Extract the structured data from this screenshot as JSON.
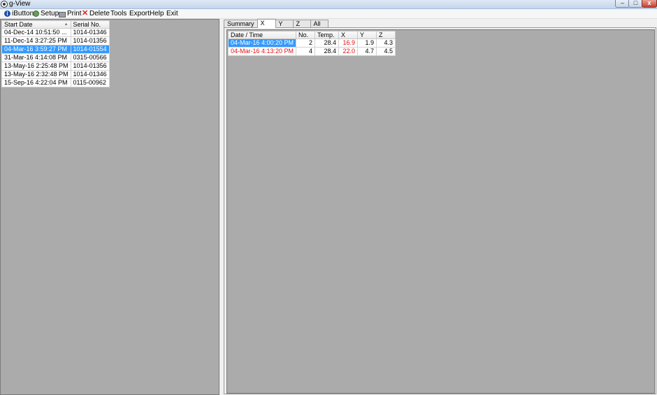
{
  "window": {
    "title": "g-View",
    "minimize": "–",
    "maximize": "□",
    "close": "x"
  },
  "menu": [
    {
      "label": "iButton",
      "icon": "info-icon"
    },
    {
      "label": "Setup",
      "icon": "gear-icon"
    },
    {
      "label": "Print",
      "icon": "printer-icon"
    },
    {
      "label": "Delete",
      "icon": "delete-x-icon"
    },
    {
      "label": "Tools"
    },
    {
      "label": "Export"
    },
    {
      "label": "Help"
    },
    {
      "label": "Exit"
    }
  ],
  "left_table": {
    "headers": [
      "Start Date",
      "Serial No."
    ],
    "rows": [
      {
        "start": "04-Dec-14 10:51:50 ...",
        "serial": "1014-01346",
        "selected": false
      },
      {
        "start": "11-Dec-14 3:27:25 PM",
        "serial": "1014-01356",
        "selected": false
      },
      {
        "start": "04-Mar-16 3:59:27 PM",
        "serial": "1014-01554",
        "selected": true
      },
      {
        "start": "31-Mar-16 4:14:08 PM",
        "serial": "0315-00566",
        "selected": false
      },
      {
        "start": "13-May-16 2:25:48 PM",
        "serial": "1014-01356",
        "selected": false
      },
      {
        "start": "13-May-16 2:32:48 PM",
        "serial": "1014-01346",
        "selected": false
      },
      {
        "start": "15-Sep-16 4:22:04 PM",
        "serial": "0115-00962",
        "selected": false
      }
    ]
  },
  "tabs": [
    {
      "label": "Summary",
      "active": false
    },
    {
      "label": "X",
      "active": true
    },
    {
      "label": "Y",
      "active": false
    },
    {
      "label": "Z",
      "active": false
    },
    {
      "label": "All",
      "active": false
    }
  ],
  "right_table": {
    "headers": [
      "Date / Time",
      "No.",
      "Temp.",
      "X",
      "Y",
      "Z"
    ],
    "rows": [
      {
        "datetime": "04-Mar-16 4:00:20 PM",
        "no": "2",
        "temp": "28.4",
        "x": "16.9",
        "y": "1.9",
        "z": "4.3",
        "selected": true
      },
      {
        "datetime": "04-Mar-16 4:13:20 PM",
        "no": "4",
        "temp": "28.4",
        "x": "22.0",
        "y": "4.7",
        "z": "4.5",
        "selected": false
      }
    ]
  },
  "colors": {
    "selection": "#3399ff",
    "alert": "#e01010",
    "empty_area": "#ababab"
  }
}
